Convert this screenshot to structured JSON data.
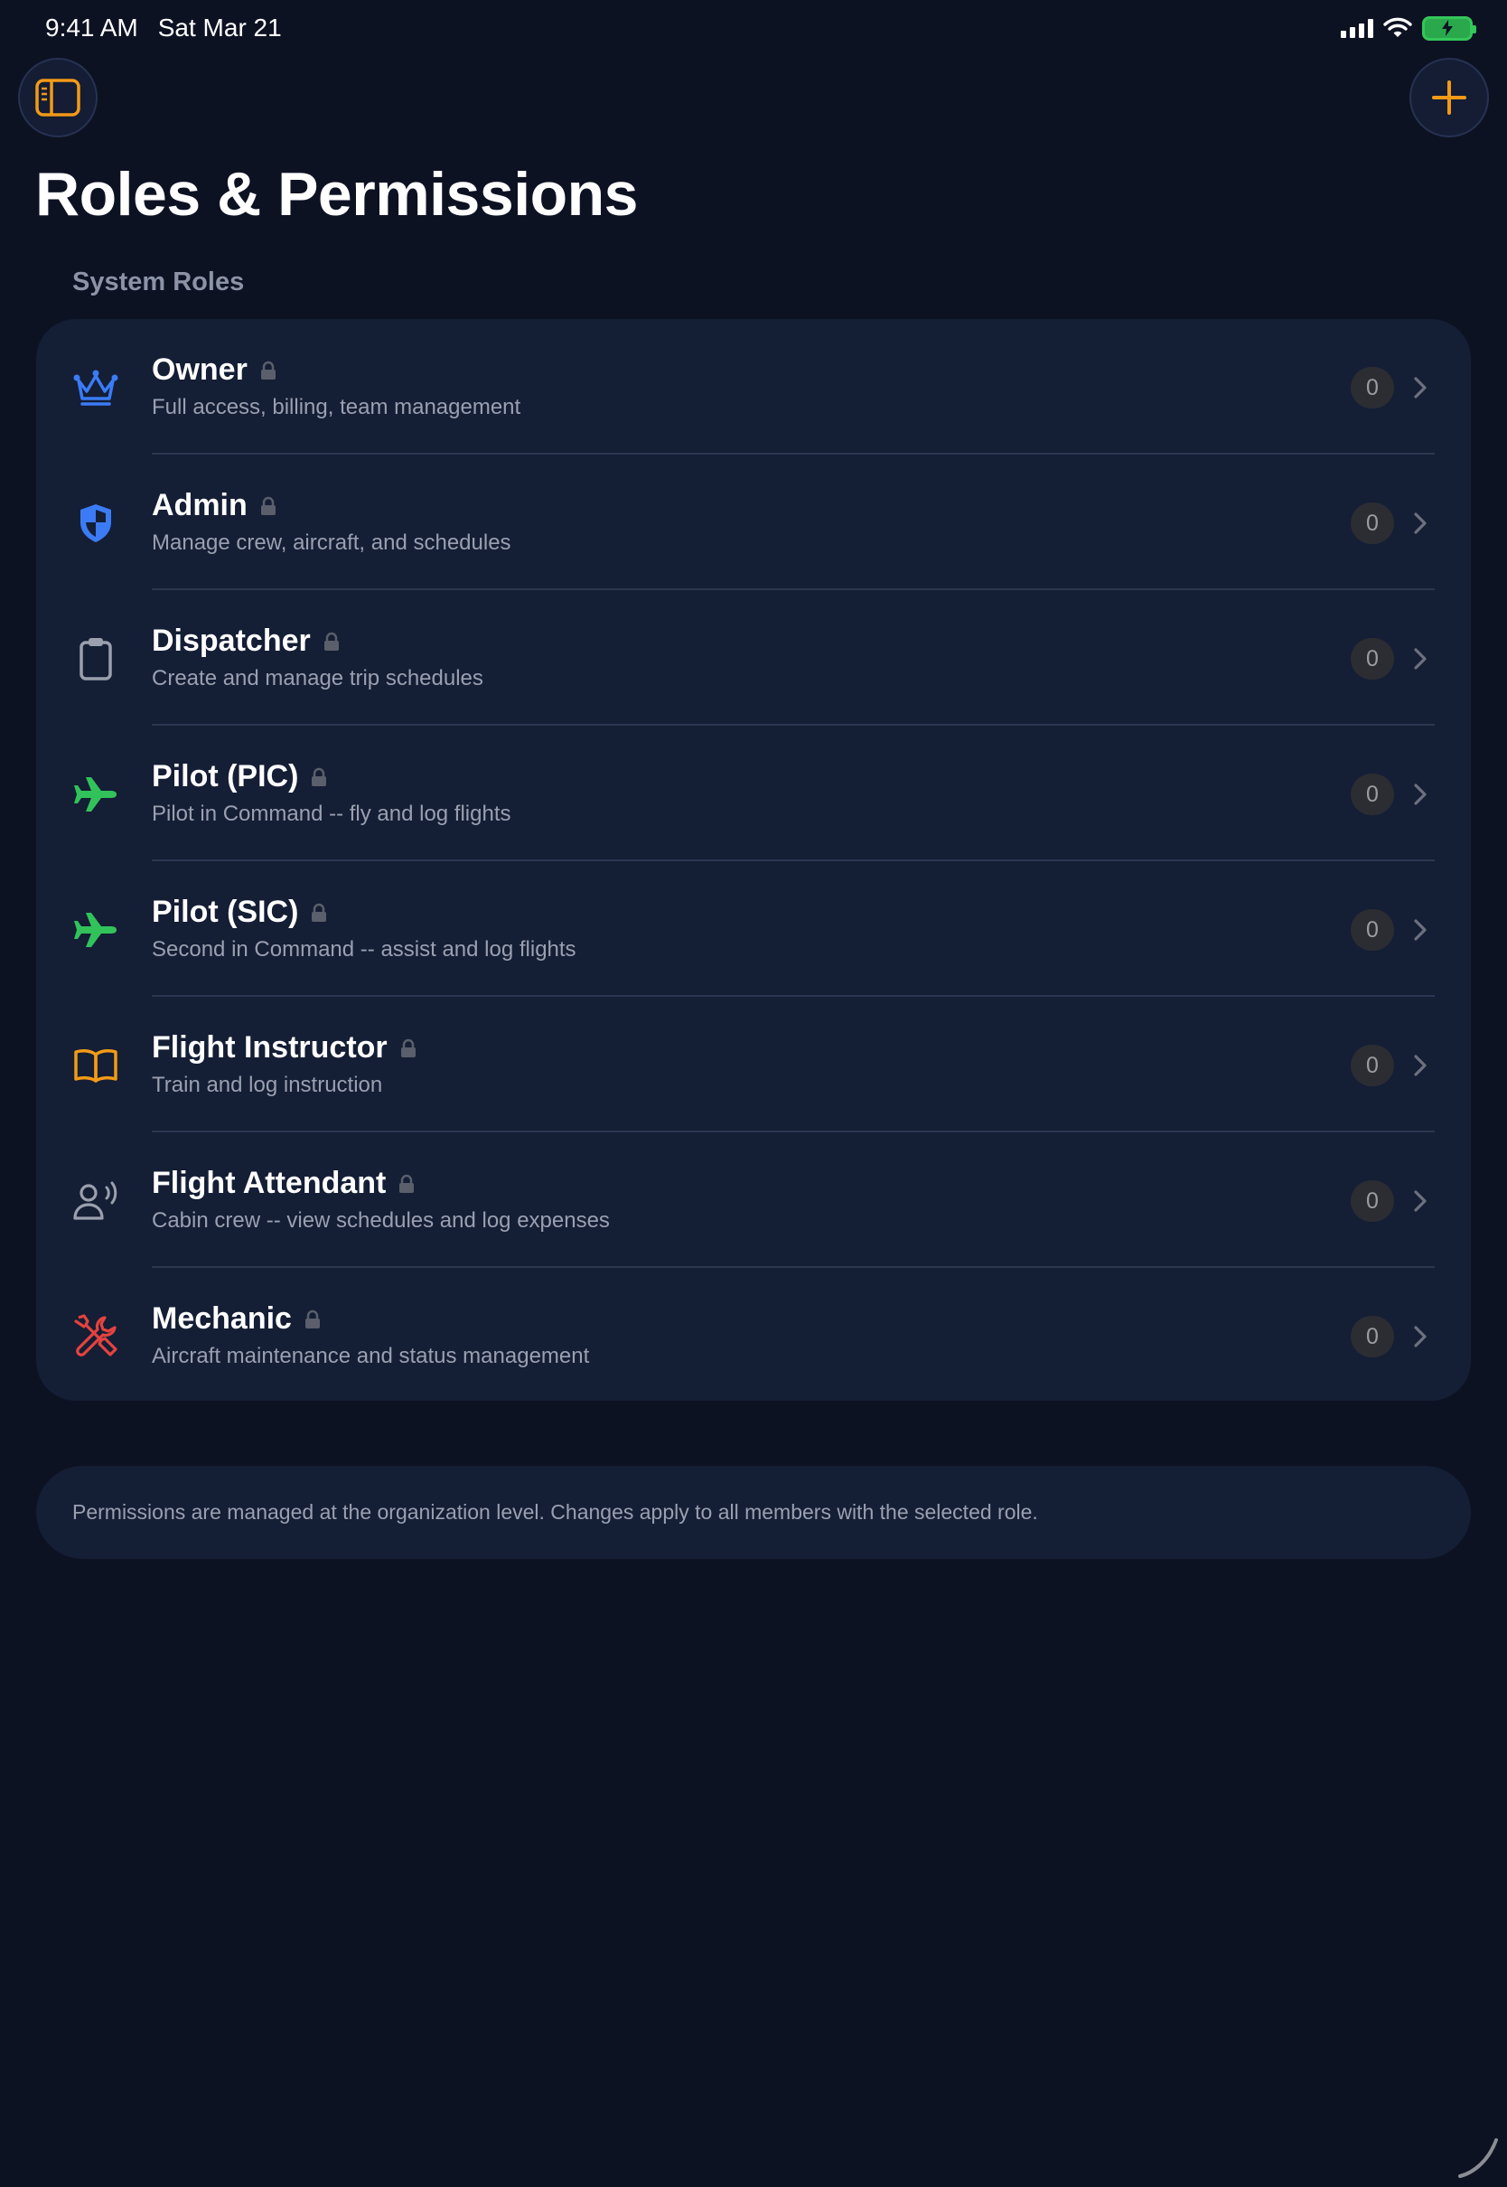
{
  "status": {
    "time": "9:41 AM",
    "date": "Sat Mar 21"
  },
  "header": {
    "title": "Roles & Permissions"
  },
  "section": {
    "title": "System Roles"
  },
  "roles": [
    {
      "name": "Owner",
      "description": "Full access, billing, team management",
      "count": "0",
      "icon": "crown-icon",
      "color": "#3b7cf6"
    },
    {
      "name": "Admin",
      "description": "Manage crew, aircraft, and schedules",
      "count": "0",
      "icon": "shield-icon",
      "color": "#3b7cf6"
    },
    {
      "name": "Dispatcher",
      "description": "Create and manage trip schedules",
      "count": "0",
      "icon": "clipboard-icon",
      "color": "#9aa0ad"
    },
    {
      "name": "Pilot (PIC)",
      "description": "Pilot in Command -- fly and log flights",
      "count": "0",
      "icon": "airplane-icon",
      "color": "#32c25a"
    },
    {
      "name": "Pilot (SIC)",
      "description": "Second in Command -- assist and log flights",
      "count": "0",
      "icon": "airplane-icon",
      "color": "#32c25a"
    },
    {
      "name": "Flight Instructor",
      "description": "Train and log instruction",
      "count": "0",
      "icon": "book-icon",
      "color": "#f29a17"
    },
    {
      "name": "Flight Attendant",
      "description": "Cabin crew -- view schedules and log expenses",
      "count": "0",
      "icon": "person-speaking-icon",
      "color": "#9aa0ad"
    },
    {
      "name": "Mechanic",
      "description": "Aircraft maintenance and status management",
      "count": "0",
      "icon": "wrench-screwdriver-icon",
      "color": "#e5433f"
    }
  ],
  "footer": {
    "note": "Permissions are managed at the organization level. Changes apply to all members with the selected role."
  },
  "colors": {
    "accent": "#f29a17",
    "background": "#0d1223",
    "card": "#141e35"
  }
}
